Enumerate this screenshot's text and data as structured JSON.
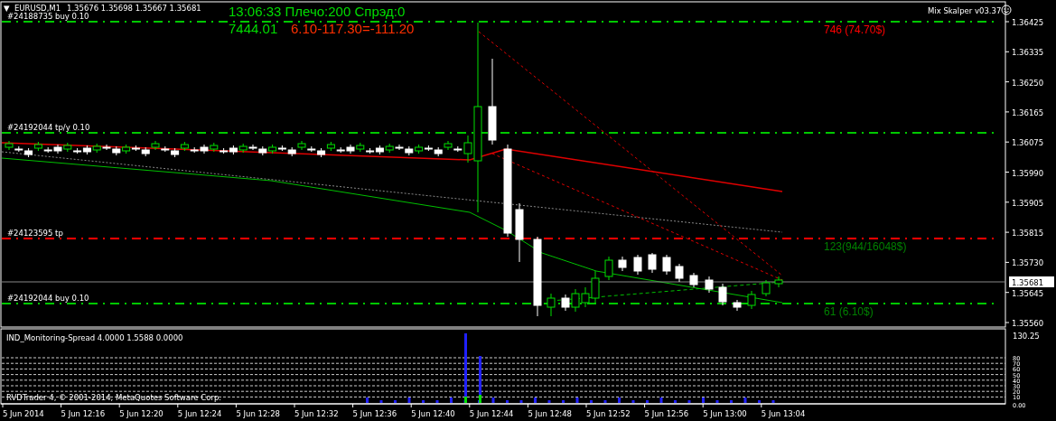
{
  "header": {
    "menu_glyph": "▼",
    "symbol": "EURUSD,M1",
    "quotes": "1.35676 1.35698 1.35667 1.35681",
    "clock": "13:06:33 Плечо:200 Спрэд:0",
    "balance": "7444.01",
    "profit": "6.10-117.30=-111.20",
    "expert": "Mix Skalper v03.37"
  },
  "order_lines": [
    {
      "label": "#24188735 buy 0.10",
      "color": "#00c800",
      "result": {
        "text": "746 (74.70$)",
        "color": "#ff0000"
      }
    },
    {
      "label": "#24192044 tp/y 0.10",
      "color": "#00c800"
    },
    {
      "label": "#24123595 tp",
      "color": "#ff0000",
      "result": {
        "text": "123(944/16048$)",
        "color": "#008000"
      }
    },
    {
      "label": "#24192044 buy 0.10",
      "color": "#00c800",
      "result": {
        "text": "61 (6.10$)",
        "color": "#008000"
      }
    }
  ],
  "price_axis": {
    "ticks": [
      "1.36425",
      "1.36335",
      "1.36250",
      "1.36165",
      "1.36075",
      "1.35990",
      "1.35905",
      "1.35815",
      "1.35730",
      "1.35645",
      "1.35560"
    ],
    "current": "1.35681"
  },
  "indicator": {
    "title": "IND_Monitoring-Spread 4.0000 1.5588 0.0000",
    "copyright": "RVDTrader 4, © 2001-2014, MetaQuotes Software Corp.",
    "max": "130.25",
    "levels": [
      "80",
      "70",
      "60",
      "50",
      "40",
      "30",
      "20",
      "10"
    ],
    "zero": "0.00"
  },
  "time_axis": [
    "5 Jun 2014",
    "5 Jun 12:16",
    "5 Jun 12:20",
    "5 Jun 12:24",
    "5 Jun 12:28",
    "5 Jun 12:32",
    "5 Jun 12:36",
    "5 Jun 12:40",
    "5 Jun 12:44",
    "5 Jun 12:48",
    "5 Jun 12:52",
    "5 Jun 12:56",
    "5 Jun 13:00",
    "5 Jun 13:04"
  ]
}
